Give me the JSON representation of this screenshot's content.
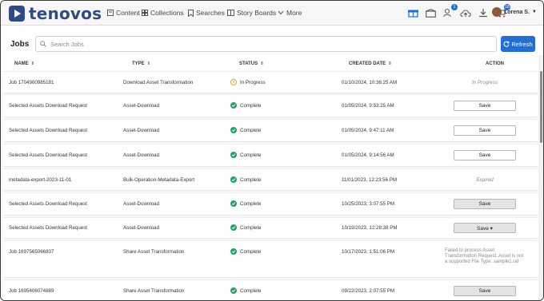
{
  "brand": {
    "name": "tenovos",
    "color": "#2f4a8a"
  },
  "nav": {
    "items": [
      {
        "label": "Content",
        "icon": "content-icon"
      },
      {
        "label": "Collections",
        "icon": "collections-icon"
      },
      {
        "label": "Searches",
        "icon": "bookmark-icon"
      },
      {
        "label": "Story Boards",
        "icon": "storyboard-icon"
      },
      {
        "label": "More",
        "icon": "chevron-down-icon"
      }
    ],
    "badges": {
      "notifications": "1",
      "cart": "18"
    },
    "user": {
      "name": "Lorena S."
    }
  },
  "toolbar": {
    "title": "Jobs",
    "search_placeholder": "Search Jobs",
    "refresh_label": "Refresh",
    "accent": "#1f6fd6"
  },
  "table": {
    "columns": [
      "NAME",
      "TYPE",
      "STATUS",
      "CREATED DATE",
      "ACTION"
    ],
    "rows": [
      {
        "name": "Job 1704900985181",
        "type": "Download Asset Transformation",
        "status": "In Progress",
        "date": "01/10/2024, 10:36:25 AM",
        "action_text": "In Progress"
      },
      {
        "name": "Selected Assets Download Request",
        "type": "Asset-Download",
        "status": "Complete",
        "date": "01/05/2024, 9:53:25 AM",
        "action_button": "Save"
      },
      {
        "name": "Selected Assets Download Request",
        "type": "Asset-Download",
        "status": "Complete",
        "date": "01/05/2024, 9:47:11 AM",
        "action_button": "Save"
      },
      {
        "name": "Selected Assets Download Request",
        "type": "Asset-Download",
        "status": "Complete",
        "date": "01/05/2024, 9:14:56 AM",
        "action_button": "Save"
      },
      {
        "name": "metadata-export-2023-11-01",
        "type": "Bulk-Operation-Metadata-Export",
        "status": "Complete",
        "date": "11/01/2023, 12:23:56 PM",
        "action_text": "Expired"
      },
      {
        "name": "Selected Assets Download Request",
        "type": "Asset-Download",
        "status": "Complete",
        "date": "10/25/2023, 3:07:55 PM",
        "action_button": "Save"
      },
      {
        "name": "Selected Assets Download Request",
        "type": "Asset-Download",
        "status": "Complete",
        "date": "10/19/2023, 12:28:38 PM",
        "action_button": "Save ▾"
      },
      {
        "name": "Job 1697565066837",
        "type": "Share Asset Transformation",
        "status": "Complete",
        "date": "10/17/2023, 1:51:06 PM",
        "action_error": "Failed to process Asset Transformation Request. Asset is not a supported File Type: sample1.raf"
      },
      {
        "name": "Job 1695406074889",
        "type": "Share Asset Transformation",
        "status": "Complete",
        "date": "09/22/2023, 2:07:55 PM",
        "action_button": "Save"
      }
    ],
    "status_colors": {
      "complete": "#27a168",
      "in_progress": "#e0a030"
    }
  }
}
